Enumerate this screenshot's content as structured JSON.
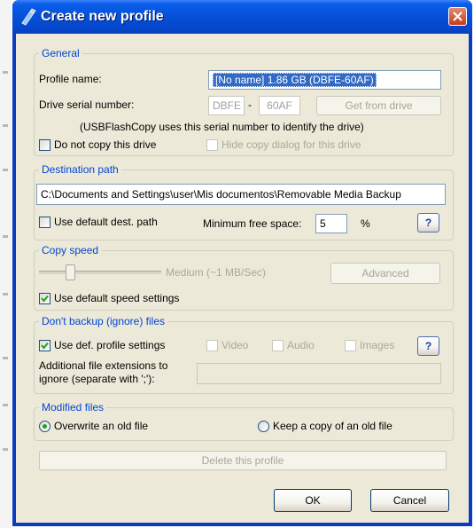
{
  "window": {
    "title": "Create new profile",
    "close_icon": "close-icon"
  },
  "general": {
    "legend": "General",
    "profile_name_label": "Profile name:",
    "profile_name_value": "[No name] 1.86 GB (DBFE-60AF)",
    "serial_label": "Drive serial number:",
    "serial_part1": "DBFE",
    "serial_sep": "-",
    "serial_part2": "60AF",
    "get_from_drive": "Get from drive",
    "note": "(USBFlashCopy uses this serial number to identify the drive)",
    "do_not_copy": {
      "label": "Do not copy this drive",
      "checked": false
    },
    "hide_copy_dialog": {
      "label": "Hide copy dialog for this drive",
      "checked": false,
      "enabled": false
    }
  },
  "destination": {
    "legend": "Destination path",
    "path": "C:\\Documents and Settings\\user\\Mis documentos\\Removable Media Backup",
    "use_default": {
      "label": "Use default dest. path",
      "checked": false
    },
    "min_free_label": "Minimum free space:",
    "min_free_value": "5",
    "percent": "%",
    "help": "?"
  },
  "speed": {
    "legend": "Copy speed",
    "slider_level_fraction": 0.25,
    "speed_text": "Medium (~1 MB/Sec)",
    "advanced": "Advanced",
    "use_default": {
      "label": "Use default speed settings",
      "checked": true
    }
  },
  "ignore": {
    "legend": "Don't backup (ignore) files",
    "use_profile": {
      "label": "Use def. profile settings",
      "checked": true
    },
    "video": {
      "label": "Video",
      "checked": false
    },
    "audio": {
      "label": "Audio",
      "checked": false
    },
    "images": {
      "label": "Images",
      "checked": false
    },
    "help": "?",
    "extensions_label_line1": "Additional file extensions to",
    "extensions_label_line2": "ignore (separate with ';'):",
    "extensions_value": ""
  },
  "modified": {
    "legend": "Modified files",
    "overwrite": {
      "label": "Overwrite an old file",
      "selected": true
    },
    "keep_copy": {
      "label": "Keep a copy of an old file",
      "selected": false
    }
  },
  "delete_profile": "Delete this profile",
  "ok": "OK",
  "cancel": "Cancel",
  "colors": {
    "titlebar": "#0550d8",
    "client": "#ece9d8",
    "legend": "#0046d5",
    "selection": "#316ac5",
    "check": "#21a121"
  }
}
